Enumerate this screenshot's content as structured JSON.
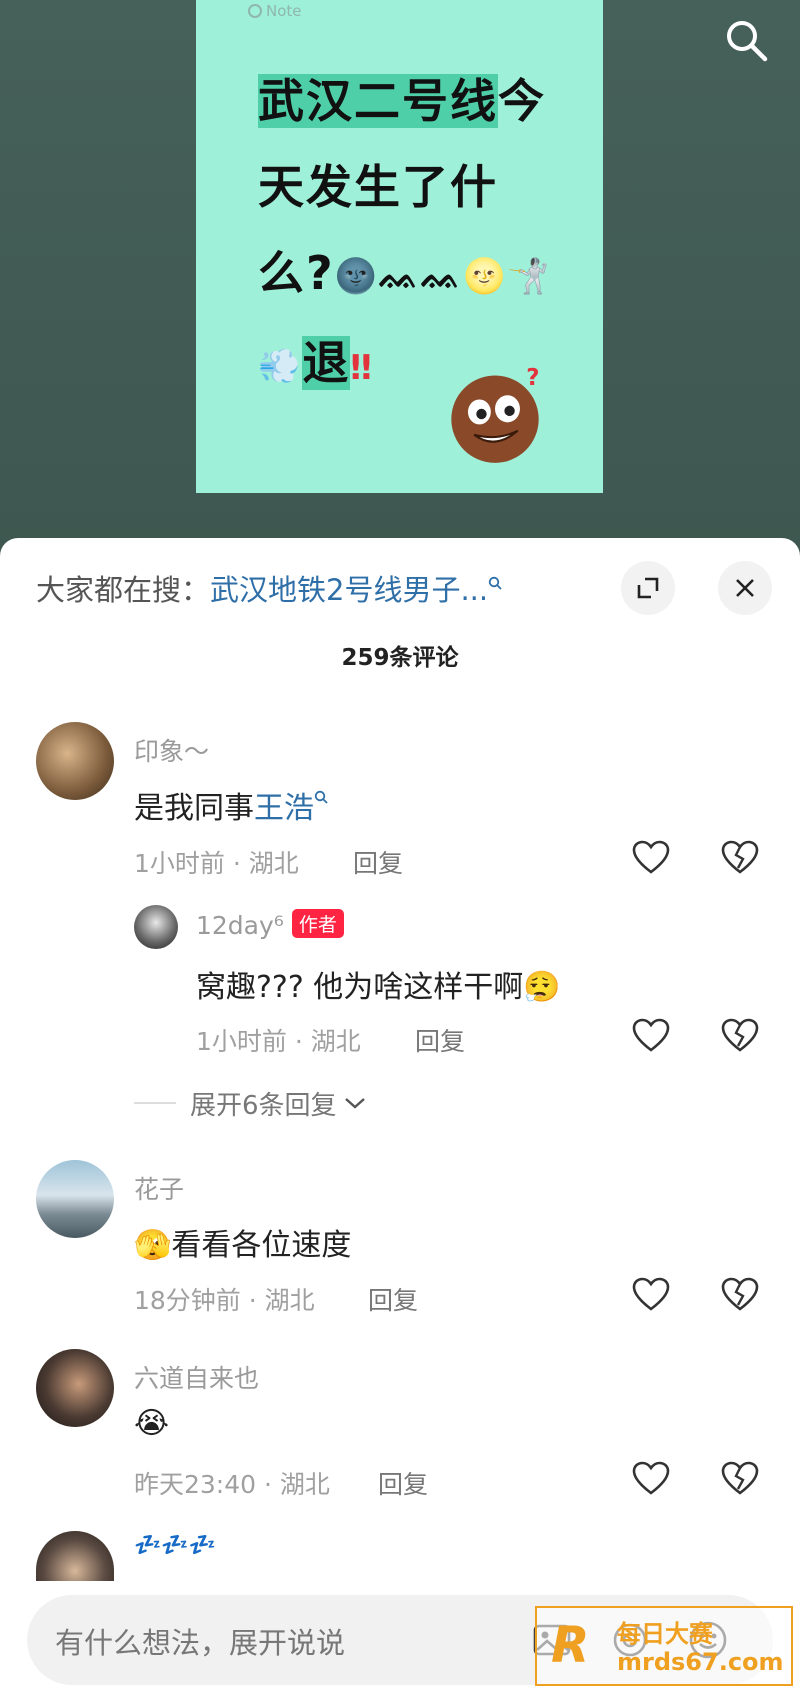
{
  "note": {
    "brand": "Note",
    "title_line1_hl": "武汉二号线",
    "title_line1_rest": "今",
    "title_line2": "天发生了什",
    "title_line3": "么?",
    "title_line3_emoji": "🌚ᨐᨐ🌝🤺",
    "title_line4_emoji": "💨",
    "title_line4_hl": "退",
    "title_line4_exc": "‼"
  },
  "sheet": {
    "trend_prefix": "大家都在搜：",
    "trend_link": "武汉地铁2号线男子...",
    "trend_link_icon": "search-icon",
    "comment_count": "259条评论"
  },
  "comments": [
    {
      "name": "印象～",
      "text_prefix": "是我同事",
      "text_keyword": "王浩",
      "time_loc": "1小时前 · 湖北",
      "reply_label": "回复"
    },
    {
      "name": "12day⁶",
      "badge": "作者",
      "text": "窝趣??? 他为啥这样干啊😮‍💨",
      "time_loc": "1小时前 · 湖北",
      "reply_label": "回复"
    },
    {
      "name": "花子",
      "text": "🫣看看各位速度",
      "time_loc": "18分钟前 · 湖北",
      "reply_label": "回复"
    },
    {
      "name": "六道自来也",
      "text": "😭",
      "time_loc": "昨天23:40 · 湖北",
      "reply_label": "回复"
    },
    {
      "name": "💤💤💤"
    }
  ],
  "expand_replies": "展开6条回复",
  "input": {
    "placeholder": "有什么想法，展开说说"
  },
  "watermark": {
    "line1": "每日大赛",
    "line2": "mrds67.com"
  },
  "colors": {
    "link": "#2f6fa8",
    "badge": "#ff2442",
    "note_bg": "#9ff0d8",
    "note_highlight": "#4ecfa8",
    "watermark": "#f0a020"
  }
}
